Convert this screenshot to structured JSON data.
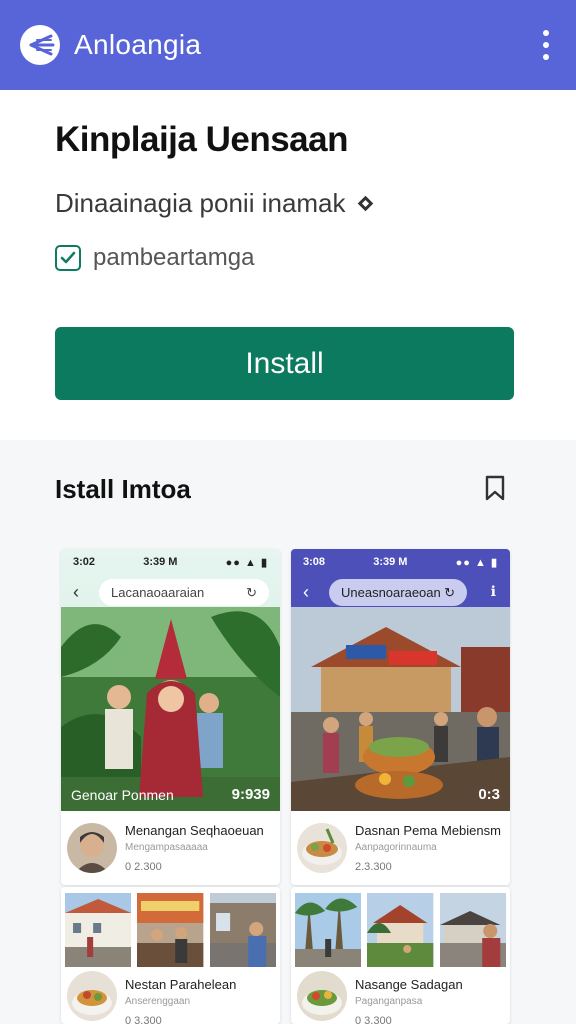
{
  "appbar": {
    "title": "Anloangia"
  },
  "app": {
    "name": "Kinplaija Uensaan",
    "subtitle": "Dinaainagia ponii inamak",
    "checkbox_label": "pambeartamga",
    "install_label": "Install"
  },
  "section": {
    "title": "Istall Imtoa"
  },
  "cards": [
    {
      "status_time": "3:02",
      "status_center": "3:39 M",
      "status_right": "●● ▲ ▮",
      "search": "Lacanaoaaraian",
      "caption": "Genoar Ponmen",
      "badge": "9:939",
      "title": "Menangan Seqhaoeuan",
      "sub": "Mengampasaaaaa",
      "num": "0 2.300"
    },
    {
      "status_time": "3:08",
      "status_center": "3:39 M",
      "status_right": "●● ▲ ▮",
      "search": "Uneasnoaraeoan",
      "caption": "",
      "badge": "0:3",
      "title": "Dasnan Pema Mebiensm",
      "sub": "Aanpagorinnauma",
      "num": "2.3.300"
    },
    {
      "title": "Nestan Parahelean",
      "sub": "Anserenggaan",
      "num": "0 3.300"
    },
    {
      "title": "Nasange Sadagan",
      "sub": "Paganganpasa",
      "num": "0 3.300"
    }
  ],
  "colors": {
    "appbar": "#5865d9",
    "install": "#0b7a5e",
    "checkbox": "#0e7a5f"
  },
  "icons": {
    "logo": "back-arrow-logo-icon",
    "menu": "more-vert-icon",
    "bookmark": "bookmark-icon",
    "check": "check-icon",
    "diamond": "diamond-icon"
  }
}
